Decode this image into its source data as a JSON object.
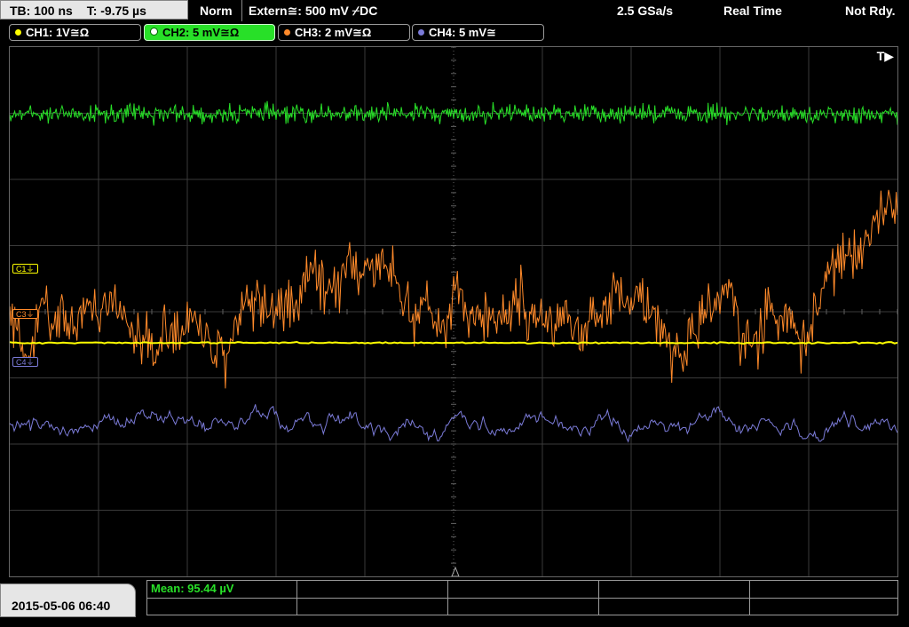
{
  "topbar": {
    "timebase": "TB: 100 ns",
    "trigger_time": "T: -9.75 µs",
    "mode": "Norm",
    "trigger_source": "Extern≅: 500 mV ⌿DC",
    "sample_rate": "2.5 GSa/s",
    "acq_mode": "Real Time",
    "status": "Not Rdy."
  },
  "channels": [
    {
      "label": "CH1: 1V≅Ω",
      "color": "#ffff00",
      "active": false
    },
    {
      "label": "CH2: 5 mV≅Ω",
      "color": "#28e028",
      "active": true
    },
    {
      "label": "CH3: 2 mV≅Ω",
      "color": "#ff8a2a",
      "active": false
    },
    {
      "label": "CH4: 5 mV≅",
      "color": "#7b7bd8",
      "active": false
    }
  ],
  "screen": {
    "trigger_marker": "T▶"
  },
  "ref_markers": {
    "c1": "C1⏚",
    "c3": "C3⏚",
    "c4": "C4⏚"
  },
  "footer": {
    "datetime": "2015-05-06 06:40",
    "measurement": "Mean: 95.44 µV"
  },
  "colors": {
    "ch1": "#ffff00",
    "ch2": "#28e028",
    "ch3": "#ff8a2a",
    "ch4": "#7b7bd8",
    "grid": "#3a3a3a",
    "center_axis": "#606060"
  }
}
